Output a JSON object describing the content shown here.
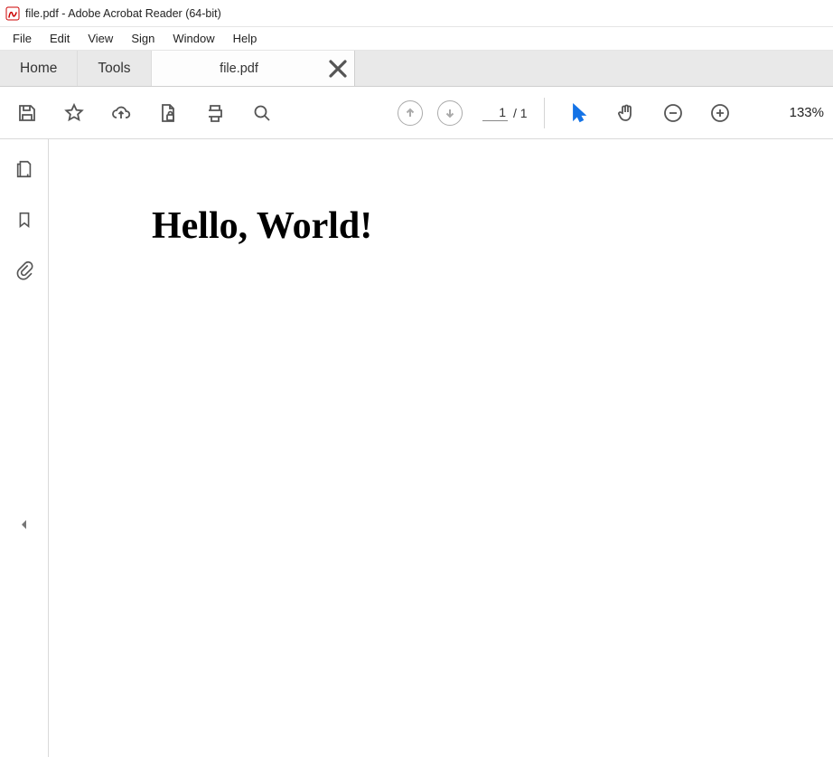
{
  "titlebar": {
    "title": "file.pdf - Adobe Acrobat Reader (64-bit)"
  },
  "menubar": {
    "items": [
      "File",
      "Edit",
      "View",
      "Sign",
      "Window",
      "Help"
    ]
  },
  "tabs": {
    "home": "Home",
    "tools": "Tools",
    "doc_label": "file.pdf"
  },
  "toolbar": {
    "page_current": "1",
    "page_total": "/ 1",
    "zoom": "133%"
  },
  "document": {
    "heading": "Hello, World!"
  }
}
